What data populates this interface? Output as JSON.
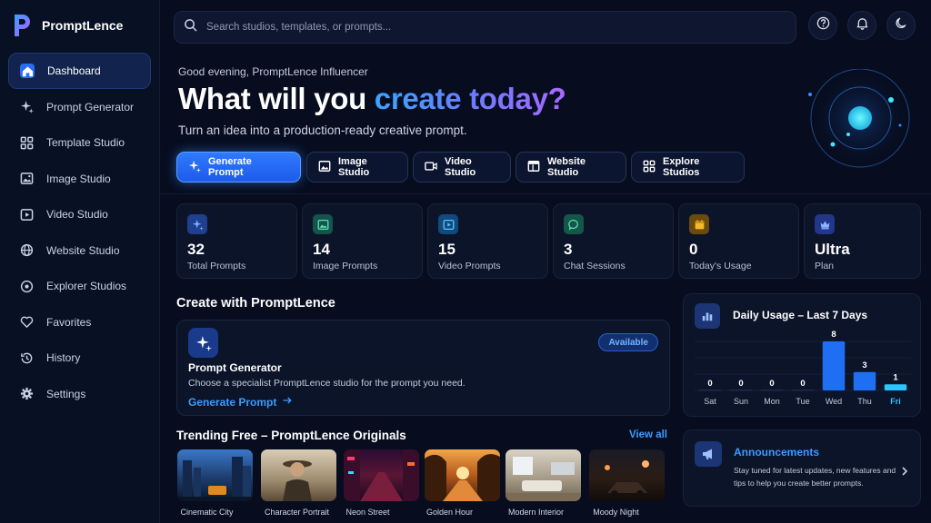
{
  "app": {
    "name": "PromptLence"
  },
  "sidebar": {
    "items": [
      {
        "label": "Dashboard",
        "icon": "home-icon",
        "active": true
      },
      {
        "label": "Prompt Generator",
        "icon": "sparkle-icon"
      },
      {
        "label": "Template Studio",
        "icon": "grid-icon"
      },
      {
        "label": "Image Studio",
        "icon": "image-icon"
      },
      {
        "label": "Video Studio",
        "icon": "play-icon"
      },
      {
        "label": "Website Studio",
        "icon": "globe-icon"
      },
      {
        "label": "Explorer Studios",
        "icon": "compass-icon"
      },
      {
        "label": "Favorites",
        "icon": "heart-icon"
      },
      {
        "label": "History",
        "icon": "history-icon"
      },
      {
        "label": "Settings",
        "icon": "gear-icon"
      }
    ]
  },
  "search": {
    "placeholder": "Search studios, templates, or prompts..."
  },
  "topbar": {
    "icons": [
      "help-icon",
      "bell-icon",
      "moon-icon"
    ]
  },
  "hero": {
    "greeting": "Good evening, PromptLence Influencer",
    "headline_plain": "What will you ",
    "headline_gradient": "create today?",
    "subhead": "Turn an idea into a production-ready creative prompt.",
    "buttons": [
      {
        "label": "Generate Prompt",
        "icon": "sparkle-icon",
        "primary": true
      },
      {
        "label": "Image Studio",
        "icon": "image-icon"
      },
      {
        "label": "Video Studio",
        "icon": "video-icon"
      },
      {
        "label": "Website Studio",
        "icon": "browser-icon"
      },
      {
        "label": "Explore Studios",
        "icon": "grid-icon"
      }
    ]
  },
  "stats": [
    {
      "value": "32",
      "label": "Total Prompts",
      "icon": "sparkle-icon",
      "color": "#2f5fd0"
    },
    {
      "value": "14",
      "label": "Image Prompts",
      "icon": "image-icon",
      "color": "#1b8a6f"
    },
    {
      "value": "15",
      "label": "Video Prompts",
      "icon": "play-icon",
      "color": "#1e73c8"
    },
    {
      "value": "3",
      "label": "Chat Sessions",
      "icon": "chat-icon",
      "color": "#178a72"
    },
    {
      "value": "0",
      "label": "Today's Usage",
      "icon": "calendar-icon",
      "color": "#c58a12"
    },
    {
      "value": "Ultra",
      "label": "Plan",
      "icon": "crown-icon",
      "color": "#2d4fc2"
    }
  ],
  "create": {
    "section_title": "Create with PromptLence",
    "card_title": "Prompt Generator",
    "card_desc": "Choose a specialist PromptLence studio for the prompt you need.",
    "badge": "Available",
    "link": "Generate Prompt"
  },
  "trending": {
    "title": "Trending Free – PromptLence Originals",
    "view_all": "View all",
    "items": [
      {
        "label": "Cinematic City"
      },
      {
        "label": "Character Portrait"
      },
      {
        "label": "Neon Street"
      },
      {
        "label": "Golden Hour"
      },
      {
        "label": "Modern Interior"
      },
      {
        "label": "Moody Night"
      }
    ]
  },
  "usage": {
    "title": "Daily Usage – Last 7 Days",
    "icon": "bar-chart-icon"
  },
  "chart_data": {
    "type": "bar",
    "title": "Daily Usage – Last 7 Days",
    "categories": [
      "Sat",
      "Sun",
      "Mon",
      "Tue",
      "Wed",
      "Thu",
      "Fri"
    ],
    "values": [
      0,
      0,
      0,
      0,
      8,
      3,
      1
    ],
    "ylim": [
      0,
      8
    ],
    "highlight_category": "Fri",
    "bar_color": "#1f6ff2",
    "grid": true
  },
  "announcements": {
    "title": "Announcements",
    "text": "Stay tuned for latest updates, new features and tips to help you create better prompts.",
    "icon": "megaphone-icon"
  },
  "colors": {
    "accent": "#2f7bff",
    "link": "#3b9bff",
    "background": "#070d1f",
    "card": "#0c1429"
  }
}
